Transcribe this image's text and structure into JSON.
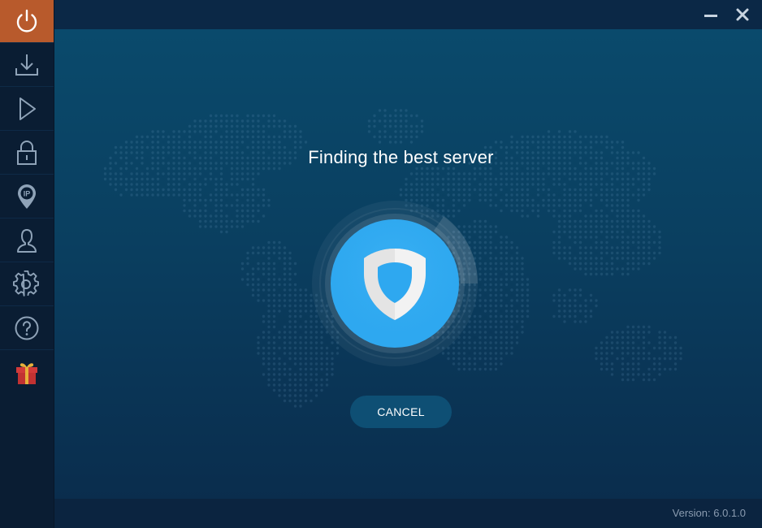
{
  "window": {
    "minimize_icon": "minimize-icon",
    "close_icon": "close-icon"
  },
  "sidebar": {
    "items": [
      {
        "icon": "power-icon",
        "active": true
      },
      {
        "icon": "download-icon"
      },
      {
        "icon": "play-icon"
      },
      {
        "icon": "lock-icon"
      },
      {
        "icon": "ip-location-icon"
      },
      {
        "icon": "user-icon"
      },
      {
        "icon": "gear-icon"
      },
      {
        "icon": "help-icon"
      },
      {
        "icon": "gift-icon"
      }
    ]
  },
  "main": {
    "status_text": "Finding the best server",
    "cancel_label": "CANCEL",
    "shield_icon": "shield-icon"
  },
  "footer": {
    "version_text": "Version:  6.0.1.0"
  },
  "colors": {
    "active_sidebar": "#b85a2c",
    "accent_blue": "#2ea8f0",
    "button_bg": "#0e4f74"
  }
}
